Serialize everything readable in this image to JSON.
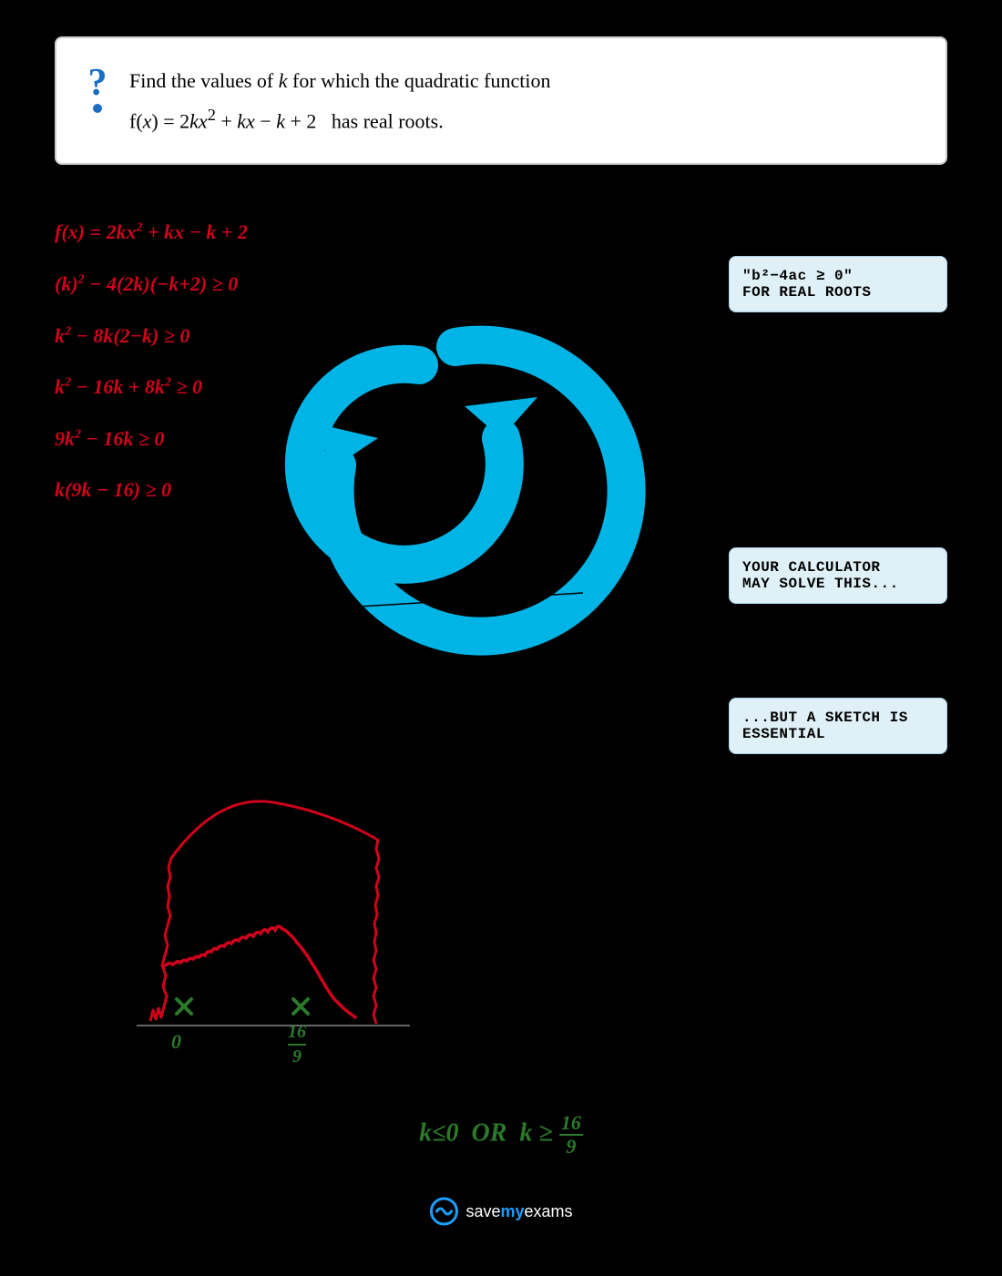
{
  "question": {
    "text": "Find the values of k for which the quadratic function",
    "formula": "f(x) = 2kx² + kx − k + 2  has real roots.",
    "icon": "?"
  },
  "steps": [
    {
      "text": "f(x) = 2kx² + kx − k + 2"
    },
    {
      "text": "(k)² − 4(2k)(−k+2) ≥ 0"
    },
    {
      "text": "k² − 8k(2−k) ≥ 0"
    },
    {
      "text": "k² − 16k + 8k² ≥ 0"
    },
    {
      "text": "9k² − 16k ≥ 0"
    },
    {
      "text": "k(9k − 16) ≥ 0"
    }
  ],
  "callouts": {
    "c1_line1": "\"b²−4ac ≥ 0\"",
    "c1_line2": "FOR  REAL  ROOTS",
    "c2_line1": "YOUR  CALCULATOR",
    "c2_line2": "MAY  SOLVE  THIS...",
    "c3_line1": "...BUT  A  SKETCH  IS",
    "c3_line2": "ESSENTIAL"
  },
  "graph": {
    "x_label_1": "0",
    "x_label_2": "16",
    "x_label_2_denom": "9"
  },
  "answer": {
    "text": "k≤0  OR  k ≥ 16/9"
  },
  "logo": {
    "text_save": "save",
    "text_my": "my",
    "text_exams": "exams"
  }
}
